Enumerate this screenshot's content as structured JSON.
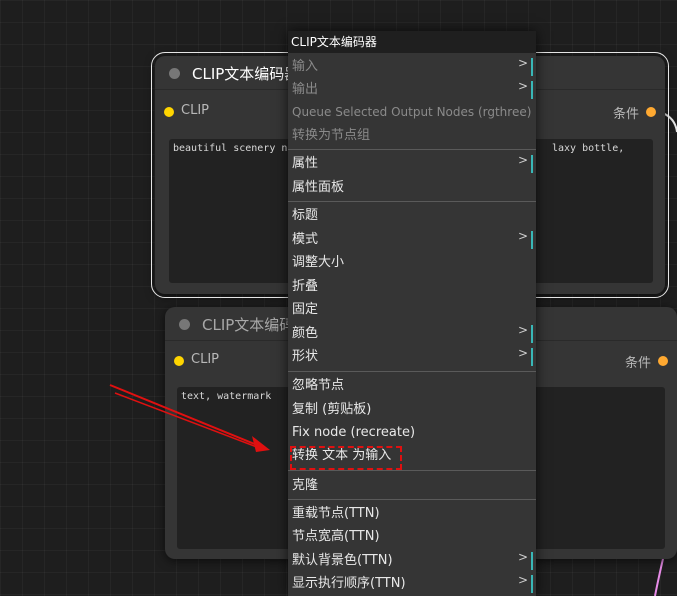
{
  "nodes": [
    {
      "title": "CLIP文本编码器",
      "input_label": "CLIP",
      "output_label": "条件",
      "text_left": "beautiful scenery na",
      "text_right": "laxy bottle,"
    },
    {
      "title": "CLIP文本编码器",
      "input_label": "CLIP",
      "output_label": "条件",
      "text_left": "text, watermark"
    }
  ],
  "context_menu": {
    "title": "CLIP文本编码器",
    "items": [
      {
        "label": "输入",
        "disabled": true,
        "submenu": true
      },
      {
        "label": "输出",
        "disabled": true,
        "submenu": true
      },
      {
        "label": "Queue Selected Output Nodes (rgthree)",
        "disabled": true
      },
      {
        "label": "转换为节点组",
        "disabled": true
      },
      {
        "label": "属性",
        "submenu": true
      },
      {
        "label": "属性面板"
      },
      {
        "label": "标题"
      },
      {
        "label": "模式",
        "submenu": true
      },
      {
        "label": "调整大小"
      },
      {
        "label": "折叠"
      },
      {
        "label": "固定"
      },
      {
        "label": "颜色",
        "submenu": true
      },
      {
        "label": "形状",
        "submenu": true
      },
      {
        "label": "忽略节点"
      },
      {
        "label": "复制 (剪贴板)"
      },
      {
        "label": "Fix node (recreate)"
      },
      {
        "label": "转换 文本 为输入"
      },
      {
        "label": "克隆"
      },
      {
        "label": "重载节点(TTN)"
      },
      {
        "label": "节点宽高(TTN)"
      },
      {
        "label": "默认背景色(TTN)",
        "submenu": true
      },
      {
        "label": "显示执行顺序(TTN)",
        "submenu": true
      }
    ],
    "submenu_arrow": ">"
  },
  "colors": {
    "canvas_bg": "#1e1e1e",
    "node_bg": "#353535",
    "clip_port": "#ffd500",
    "conditioning_port": "#ffa931",
    "menu_submenu_accent": "#39b7b7",
    "annotation_red": "#e01010",
    "wire_pink": "#e88ce8"
  },
  "icons": {
    "node_collapse": "circle-dot-icon",
    "submenu": "chevron-right-icon"
  }
}
